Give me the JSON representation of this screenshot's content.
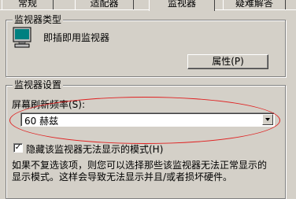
{
  "tabs": [
    {
      "label": "常规"
    },
    {
      "label": "适配器"
    },
    {
      "label": "监视器"
    },
    {
      "label": "疑难解答"
    }
  ],
  "monitor_type": {
    "title": "监视器类型",
    "monitor_name": "即插即用监视器",
    "properties_button": "属性(P)"
  },
  "monitor_settings": {
    "title": "监视器设置",
    "refresh_label": "屏幕刷新频率(S):",
    "refresh_value": "60 赫兹",
    "hide_modes_label": "隐藏该监视器无法显示的模式(H)",
    "hide_modes_checked": true,
    "note_line1": "如果不复选该项，则您可以选择那些该监视器无法正常显示的",
    "note_line2": "显示模式。这样会导致无法显示并且/或者损坏硬件。"
  },
  "annotation_color": "#e02020"
}
